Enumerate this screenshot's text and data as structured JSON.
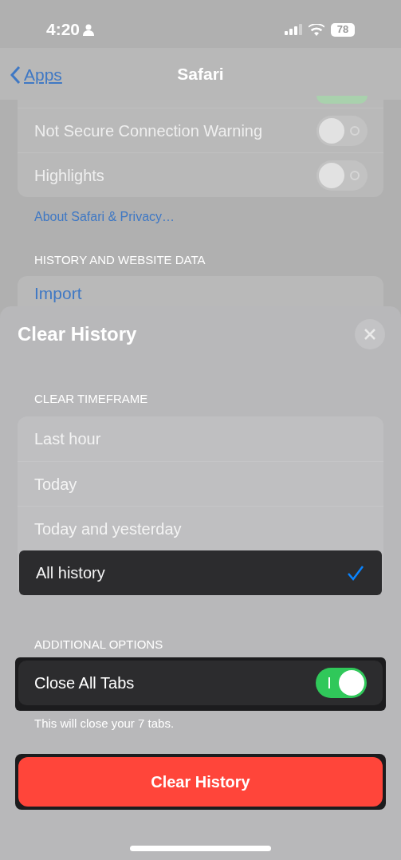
{
  "status_bar": {
    "time": "4:20",
    "battery": "78"
  },
  "nav": {
    "back": "Apps",
    "title": "Safari"
  },
  "settings_rows": [
    {
      "label": "Not Secure Connection Warning",
      "on": false
    },
    {
      "label": "Highlights",
      "on": false
    }
  ],
  "about_link": "About Safari & Privacy…",
  "history_section": {
    "header": "HISTORY AND WEBSITE DATA",
    "items": [
      "Import"
    ]
  },
  "sheet": {
    "title": "Clear History",
    "timeframe": {
      "header": "CLEAR TIMEFRAME",
      "options": [
        {
          "label": "Last hour",
          "selected": false
        },
        {
          "label": "Today",
          "selected": false
        },
        {
          "label": "Today and yesterday",
          "selected": false
        },
        {
          "label": "All history",
          "selected": true
        }
      ]
    },
    "additional": {
      "header": "ADDITIONAL OPTIONS",
      "toggle": {
        "label": "Close All Tabs",
        "on": true
      },
      "footnote": "This will close your 7 tabs."
    },
    "button": "Clear History"
  }
}
